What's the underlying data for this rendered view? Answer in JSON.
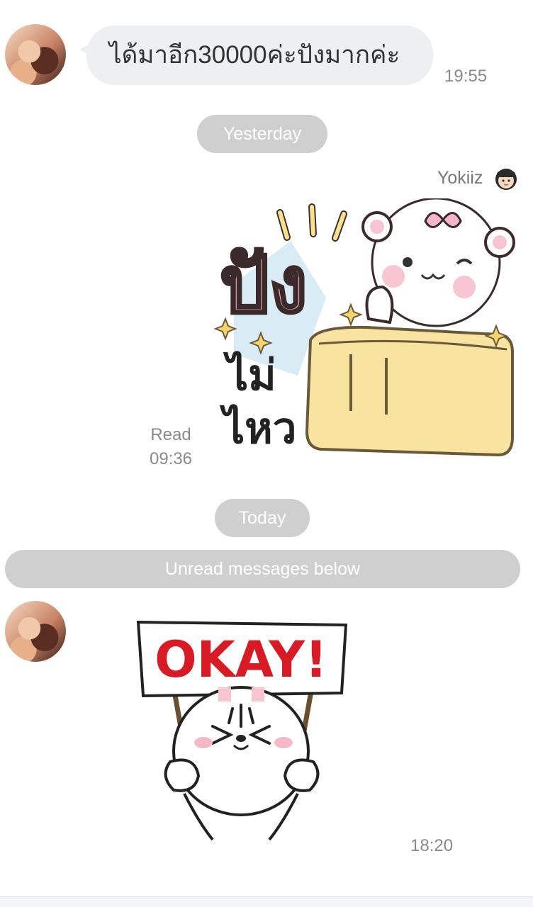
{
  "messages": [
    {
      "type": "text",
      "text": "ได้มาอีก30000ค่ะปังมากค่ะ",
      "time": "19:55"
    }
  ],
  "separators": {
    "yesterday": "Yesterday",
    "today": "Today",
    "unread": "Unread messages below"
  },
  "sticker_message_1": {
    "sender": "Yokiiz",
    "sticker_text_top": "ปัง",
    "sticker_text_line1": "ไม่",
    "sticker_text_line2": "ไหว",
    "read_label": "Read",
    "time": "09:36"
  },
  "sticker_message_2": {
    "sign_text": "OKAY!",
    "time": "18:20"
  }
}
